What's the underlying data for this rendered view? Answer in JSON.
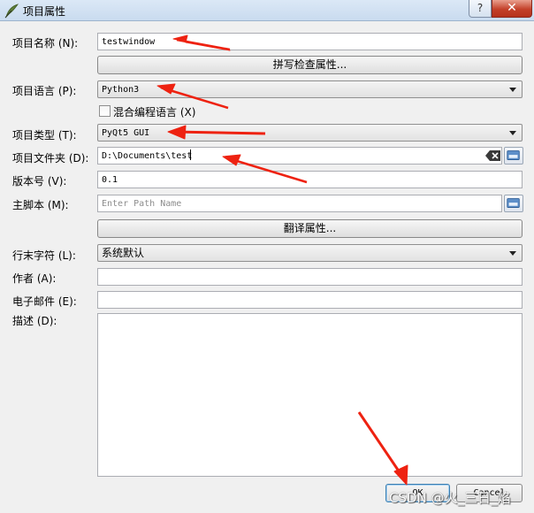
{
  "window": {
    "title": "项目属性",
    "help": "?",
    "close": "✕"
  },
  "labels": {
    "project_name": "项目名称 (N):",
    "project_language": "项目语言 (P):",
    "project_type": "项目类型 (T):",
    "project_folder": "项目文件夹 (D):",
    "version": "版本号 (V):",
    "main_script": "主脚本 (M):",
    "eol": "行末字符 (L):",
    "author": "作者 (A):",
    "email": "电子邮件 (E):",
    "description": "描述 (D):"
  },
  "fields": {
    "project_name": "testwindow",
    "project_language": "Python3",
    "project_type": "PyQt5 GUI",
    "project_folder": "D:\\Documents\\test",
    "version": "0.1",
    "main_script_placeholder": "Enter Path Name",
    "eol": "系统默认",
    "author": "",
    "email": "",
    "description": ""
  },
  "checkbox": {
    "mixed_language": "混合编程语言 (X)",
    "checked": false
  },
  "buttons": {
    "spell_check": "拼写检查属性...",
    "translation": "翻译属性...",
    "ok": "OK",
    "cancel": "Cancel"
  },
  "watermark": "CSDN @火_三日_焰",
  "colors": {
    "annotation_arrow": "#ee2211"
  },
  "icons": {
    "app": "feather-icon",
    "clear": "clear-icon",
    "folder_browse": "folder-browse-icon",
    "file_browse": "file-browse-icon"
  }
}
